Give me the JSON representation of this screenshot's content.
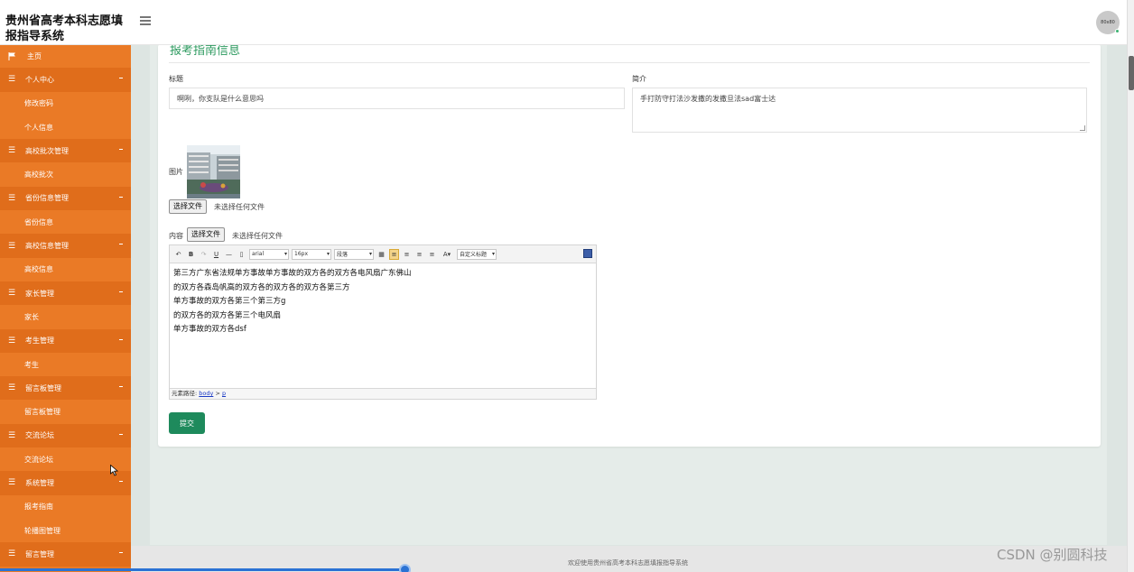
{
  "app": {
    "title": "贵州省高考本科志愿填报指导系统",
    "avatar_text": "80x80"
  },
  "sidebar": {
    "items": [
      {
        "label": "主页",
        "type": "home",
        "icon": "flag-icon"
      },
      {
        "label": "个人中心",
        "type": "group",
        "icon": "hamburger-icon"
      },
      {
        "label": "修改密码",
        "type": "sub"
      },
      {
        "label": "个人信息",
        "type": "sub"
      },
      {
        "label": "高校批次管理",
        "type": "group",
        "icon": "hamburger-icon"
      },
      {
        "label": "高校批次",
        "type": "sub"
      },
      {
        "label": "省份信息管理",
        "type": "group",
        "icon": "hamburger-icon"
      },
      {
        "label": "省份信息",
        "type": "sub"
      },
      {
        "label": "高校信息管理",
        "type": "group",
        "icon": "hamburger-icon"
      },
      {
        "label": "高校信息",
        "type": "sub"
      },
      {
        "label": "家长管理",
        "type": "group",
        "icon": "hamburger-icon"
      },
      {
        "label": "家长",
        "type": "sub"
      },
      {
        "label": "考生管理",
        "type": "group",
        "icon": "hamburger-icon"
      },
      {
        "label": "考生",
        "type": "sub"
      },
      {
        "label": "留言板管理",
        "type": "group",
        "icon": "hamburger-icon"
      },
      {
        "label": "留言板管理",
        "type": "sub"
      },
      {
        "label": "交流论坛",
        "type": "group",
        "icon": "hamburger-icon"
      },
      {
        "label": "交流论坛",
        "type": "sub"
      },
      {
        "label": "系统管理",
        "type": "group",
        "icon": "hamburger-icon"
      },
      {
        "label": "报考指南",
        "type": "sub"
      },
      {
        "label": "轮播图管理",
        "type": "sub"
      },
      {
        "label": "留言管理",
        "type": "group",
        "icon": "hamburger-icon"
      }
    ]
  },
  "form": {
    "section_title": "报考指南信息",
    "title_label": "标题",
    "title_value": "啊咧，你支队是什么意思吗",
    "intro_label": "简介",
    "intro_value": "手打防守打法沙发撒的发撒旦法sad富士达",
    "image_label": "图片",
    "image_file_button": "选择文件",
    "image_file_status": "未选择任何文件",
    "content_label": "内容",
    "content_file_button": "选择文件",
    "content_file_status": "未选择任何文件",
    "submit_label": "提交"
  },
  "editor": {
    "font_family": "arial",
    "font_size": "16px",
    "paragraph": "段落",
    "custom_title": "自定义标题",
    "lines": [
      "第三方广东省法规单方事故单方事故的双方各的双方各电风扇广东佛山",
      "的双方各森岛帆高的双方各的双方各的双方各第三方",
      "单方事故的双方各第三个第三方g",
      "的双方各的双方各第三个电风扇",
      "单方事故的双方各dsf"
    ],
    "path_prefix": "元素路径:",
    "path_body": "body",
    "path_sep": ">",
    "path_p": "p"
  },
  "footer": {
    "text": "欢迎使用贵州省高考本科志愿填报指导系统"
  },
  "watermark": "CSDN @别圆科技",
  "colors": {
    "sidebar_bg": "#ea7a26",
    "sidebar_group_bg": "#e06d1b",
    "accent_green": "#2d9a5f",
    "submit_green": "#1e8a5c"
  }
}
